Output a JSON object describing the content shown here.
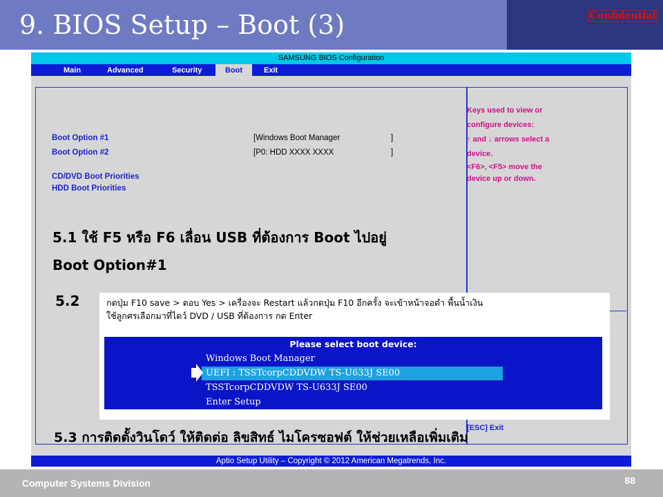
{
  "slide": {
    "title": "9. BIOS Setup – Boot (3)",
    "confidential": "Confidential",
    "footer_division": "Computer Systems  Division",
    "page_number": "88"
  },
  "bios": {
    "header": "SAMSUNG BIOS Configuration",
    "tabs": [
      "Main",
      "Advanced",
      "Security",
      "Boot",
      "Exit"
    ],
    "active_tab": "Boot",
    "boot_options": [
      {
        "label": "Boot Option #1",
        "value": "[Windows Boot Manager",
        "close": "]"
      },
      {
        "label": "Boot Option #2",
        "value": "[P0: HDD XXXX XXXX",
        "close": "]"
      }
    ],
    "priorities": [
      "CD/DVD Boot Priorities",
      "HDD Boot Priorities"
    ],
    "help_lines": [
      "Keys used to view or",
      "configure devices:",
      "↑ and ↓ arrows select a",
      "device.",
      "<F6>, <F5> move the",
      "device up or down."
    ],
    "esc_exit": "[ESC]   Exit",
    "footer": "Aptio Setup Utility – Copyright © 2012 American Megatrends, Inc."
  },
  "steps": {
    "s51_line1": "5.1     ใช้ F5 หรือ F6 เลื่อน USB ที่ต้องการ Boot ไปอยู่",
    "s51_line2": "Boot Option#1",
    "s52_num": "5.2",
    "s52_line1": "กดปุ่ม   F10 save > ตอบ   Yes > เครื่องจะ   Restart  แล้วกดปุ่ม   F10  อีกครั้ง   จะเข้าหน้าจอดำ   พื้นน้ำเงิน",
    "s52_line2": "ใช้ลูกศรเลือกมาที่ไดว์   DVD / USB ที่ต้องการ   กด    Enter",
    "s53": "5.3   การติดตั้งวินโดว์ ให้ติดต่อ ลิขสิทธ์ ไมโครซอฟต์ ให้ช่วยเหลือเพิ่มเติม"
  },
  "boot_menu": {
    "title": "Please select boot device:",
    "items": [
      "Windows Boot Manager",
      "UEFI : TSSTcorpCDDVDW TS-U633J SE00",
      "TSSTcorpCDDVDW TS-U633J SE00",
      "Enter Setup"
    ],
    "selected_index": 1,
    "selection_color": "#1ea2e0"
  },
  "colors": {
    "header_bg": "#6e7bc2",
    "header_dark": "#2b3580",
    "bios_blue": "#0d1cd6",
    "bios_cyan": "#00c8e8",
    "help_magenta": "#d0108c"
  }
}
